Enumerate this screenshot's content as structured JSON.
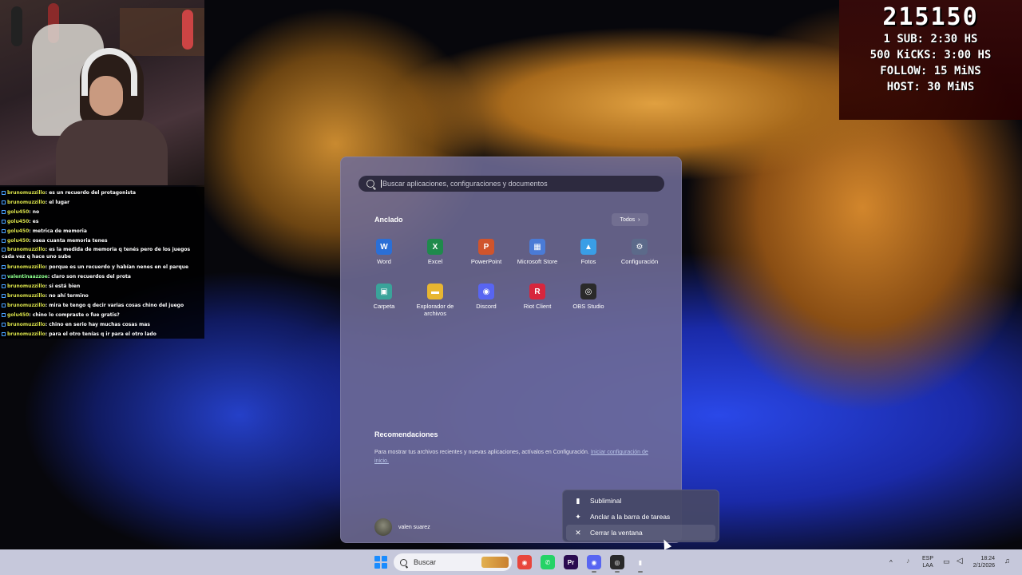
{
  "overlay": {
    "goals": {
      "counter": "215150",
      "lines": [
        "1 SUB: 2:30 HS",
        "500 KiCKS: 3:00 HS",
        "FOLLOW: 15 MiNS",
        "HOST: 30 MiNS"
      ]
    },
    "chat": [
      {
        "user": "brunomuzzillo",
        "msg": ": es un recuerdo del protagonista",
        "c": "u1"
      },
      {
        "user": "brunomuzzillo",
        "msg": ": el lugar",
        "c": "u1"
      },
      {
        "user": "golu450",
        "msg": ": no",
        "c": "u1"
      },
      {
        "user": "golu450",
        "msg": ": es",
        "c": "u1"
      },
      {
        "user": "golu450",
        "msg": ": metrica de memoria",
        "c": "u1"
      },
      {
        "user": "golu450",
        "msg": ": osea cuanta memoria tenes",
        "c": "u1"
      },
      {
        "user": "brunomuzzillo",
        "msg": ": es la medida de memoria q tenés pero de los juegos cada vez q hace uno sube",
        "c": "u1",
        "wrap": true
      },
      {
        "user": "brunomuzzillo",
        "msg": ": porque es un recuerdo y habían nenes en el parque",
        "c": "u1"
      },
      {
        "user": "valentinaazzoe",
        "msg": ": claro son recuerdos del prota",
        "c": "u3"
      },
      {
        "user": "brunomuzzillo",
        "msg": ": si está bien",
        "c": "u1"
      },
      {
        "user": "brunomuzzillo",
        "msg": ": no ahí termino",
        "c": "u1"
      },
      {
        "user": "brunomuzzillo",
        "msg": ": mira te tengo q decir varias cosas chino del juego",
        "c": "u1"
      },
      {
        "user": "golu450",
        "msg": ": chino lo compraste o fue gratis?",
        "c": "u1"
      },
      {
        "user": "brunomuzzillo",
        "msg": ": chino en serio hay muchas cosas mas",
        "c": "u1"
      },
      {
        "user": "brunomuzzillo",
        "msg": ": para el otro tenías q ir para el otro lado",
        "c": "u1"
      }
    ]
  },
  "start_menu": {
    "search_placeholder": "Buscar aplicaciones, configuraciones y documentos",
    "pinned_title": "Anclado",
    "all_button": "Todos",
    "apps": [
      {
        "label": "Word",
        "icon": "word-icon",
        "color": "#2b6fd6",
        "glyph": "W"
      },
      {
        "label": "Excel",
        "icon": "excel-icon",
        "color": "#1f8a4c",
        "glyph": "X"
      },
      {
        "label": "PowerPoint",
        "icon": "powerpoint-icon",
        "color": "#d0542c",
        "glyph": "P"
      },
      {
        "label": "Microsoft Store",
        "icon": "store-icon",
        "color": "#4a7bd6",
        "glyph": "▦"
      },
      {
        "label": "Fotos",
        "icon": "photos-icon",
        "color": "#3a9ee6",
        "glyph": "▲"
      },
      {
        "label": "Configuración",
        "icon": "settings-icon",
        "color": "#5c6a8a",
        "glyph": "⚙"
      },
      {
        "label": "Carpeta",
        "icon": "folder-icon",
        "color": "#3aa39a",
        "glyph": "▣"
      },
      {
        "label": "Explorador de archivos",
        "icon": "file-explorer-icon",
        "color": "#e8b631",
        "glyph": "▬"
      },
      {
        "label": "Discord",
        "icon": "discord-icon",
        "color": "#5865f2",
        "glyph": "◉"
      },
      {
        "label": "Riot Client",
        "icon": "riot-client-icon",
        "color": "#d7263d",
        "glyph": "R"
      },
      {
        "label": "OBS Studio",
        "icon": "obs-icon",
        "color": "#2a2a2a",
        "glyph": "◎"
      }
    ],
    "recommendations_title": "Recomendaciones",
    "recommendations_text": "Para mostrar tus archivos recientes y nuevas aplicaciones, actívalos en Configuración.",
    "recommendations_link": "Iniciar configuración de inicio.",
    "user_name": "valen suarez"
  },
  "context_menu": {
    "items": [
      {
        "label": "Subliminal",
        "icon": "app-icon",
        "glyph": "▮"
      },
      {
        "label": "Anclar a la barra de tareas",
        "icon": "pin-icon",
        "glyph": "✦"
      },
      {
        "label": "Cerrar la ventana",
        "icon": "close-icon",
        "glyph": "✕"
      }
    ]
  },
  "taskbar": {
    "search_label": "Buscar",
    "apps": [
      {
        "name": "chrome",
        "icon": "chrome-icon",
        "color": "#e8453c",
        "glyph": "◉"
      },
      {
        "name": "whatsapp",
        "icon": "whatsapp-icon",
        "color": "#25d366",
        "glyph": "✆"
      },
      {
        "name": "premiere",
        "icon": "premiere-icon",
        "color": "#2a0b50",
        "glyph": "Pr"
      },
      {
        "name": "discord",
        "icon": "discord-icon",
        "color": "#5865f2",
        "glyph": "◉"
      },
      {
        "name": "obs",
        "icon": "obs-icon",
        "color": "#2a2a2a",
        "glyph": "◎"
      },
      {
        "name": "subliminal",
        "icon": "subliminal-icon",
        "color": "#ffffff",
        "glyph": "▮"
      }
    ],
    "tray": {
      "lang_top": "ESP",
      "lang_bottom": "LAA",
      "time": "18:24",
      "date": "2/1/2026"
    }
  }
}
